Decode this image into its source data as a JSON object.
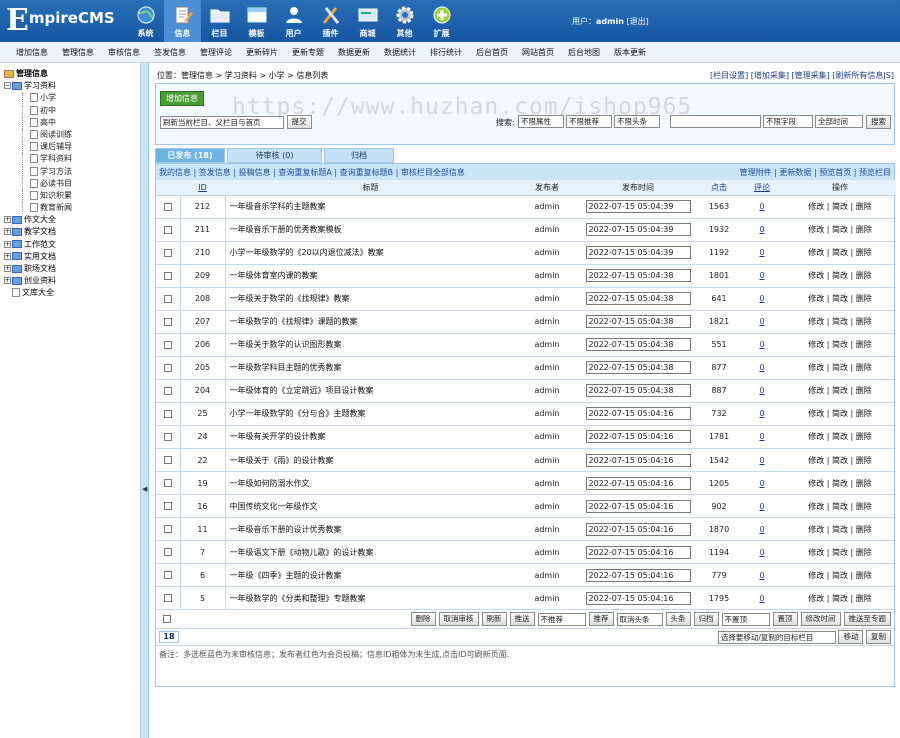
{
  "header": {
    "logo_first": "E",
    "logo_rest": "mpireCMS",
    "nav": [
      {
        "label": "系统",
        "icon": "globe-icon"
      },
      {
        "label": "信息",
        "icon": "pencil-doc-icon",
        "active": true
      },
      {
        "label": "栏目",
        "icon": "folder-icon"
      },
      {
        "label": "模板",
        "icon": "window-icon"
      },
      {
        "label": "用户",
        "icon": "user-icon"
      },
      {
        "label": "插件",
        "icon": "tools-icon"
      },
      {
        "label": "商城",
        "icon": "card-icon"
      },
      {
        "label": "其他",
        "icon": "gear-icon"
      },
      {
        "label": "扩展",
        "icon": "plus-icon"
      }
    ],
    "user_label": "用户：",
    "user_name": "admin",
    "logout": "[退出]"
  },
  "subnav": [
    "增加信息",
    "管理信息",
    "审核信息",
    "签发信息",
    "管理评论",
    "更新碎片",
    "更新专题",
    "数据更新",
    "数据统计",
    "排行统计",
    "后台首页",
    "网站首页",
    "后台地图",
    "版本更新"
  ],
  "sidebar": {
    "root": "管理信息",
    "groups": [
      {
        "label": "学习资料",
        "expanded": true,
        "children": [
          "小学",
          "初中",
          "高中",
          "阅读训练",
          "课后辅导",
          "学科资料",
          "学习方法",
          "必读书目",
          "知识积累",
          "教育新闻"
        ]
      },
      {
        "label": "作文大全"
      },
      {
        "label": "教学文档"
      },
      {
        "label": "工作范文"
      },
      {
        "label": "实用文档"
      },
      {
        "label": "职场文档"
      },
      {
        "label": "创业资料"
      },
      {
        "label": "文库大全",
        "leaf": true
      }
    ]
  },
  "crumbs": {
    "prefix": "位置：",
    "items": [
      "管理信息",
      "学习资料",
      "小学",
      "信息列表"
    ],
    "sep": " > "
  },
  "crumb_links": "[栏目设置] [增加采集] [管理采集] [刷新所有信息JS]",
  "toolbox": {
    "add_button": "增加信息",
    "refresh_select": "刷新当前栏目、父栏目与首页",
    "submit_button": "提交",
    "search_label": "搜索:",
    "filters": [
      "不限属性",
      "不限推荐",
      "不限头条"
    ],
    "search_value": "",
    "field_select": "不限字段",
    "time_select": "全部时间",
    "search_button": "搜索"
  },
  "tabs": [
    "已发布 (18)",
    "待审核 (0)",
    "归档"
  ],
  "linkbar_left": "我的信息 | 签发信息 | 投稿信息 | 查询重复标题A | 查询重复标题B | 审核栏目全部信息",
  "linkbar_right": "管理附件 | 更新数据 | 预览首页 | 预览栏目",
  "columns": [
    "ID",
    "标题",
    "发布者",
    "发布时间",
    "点击",
    "评论",
    "操作"
  ],
  "rows": [
    {
      "id": "212",
      "title": "一年级音乐学科的主题教案",
      "author": "admin",
      "time": "2022-07-15 05:04:39",
      "clicks": "1563",
      "comments": "0"
    },
    {
      "id": "211",
      "title": "一年级音乐下册的优秀教案模板",
      "author": "admin",
      "time": "2022-07-15 05:04:39",
      "clicks": "1932",
      "comments": "0"
    },
    {
      "id": "210",
      "title": "小学一年级数学的《20以内退位减法》教案",
      "author": "admin",
      "time": "2022-07-15 05:04:39",
      "clicks": "1192",
      "comments": "0"
    },
    {
      "id": "209",
      "title": "一年级体育室内课的教案",
      "author": "admin",
      "time": "2022-07-15 05:04:38",
      "clicks": "1801",
      "comments": "0"
    },
    {
      "id": "208",
      "title": "一年级关于数学的《找规律》教案",
      "author": "admin",
      "time": "2022-07-15 05:04:38",
      "clicks": "641",
      "comments": "0"
    },
    {
      "id": "207",
      "title": "一年级数学的《找规律》课题的教案",
      "author": "admin",
      "time": "2022-07-15 05:04:38",
      "clicks": "1821",
      "comments": "0"
    },
    {
      "id": "206",
      "title": "一年级关于数学的认识图形教案",
      "author": "admin",
      "time": "2022-07-15 05:04:38",
      "clicks": "551",
      "comments": "0"
    },
    {
      "id": "205",
      "title": "一年级数学科目主题的优秀教案",
      "author": "admin",
      "time": "2022-07-15 05:04:38",
      "clicks": "877",
      "comments": "0"
    },
    {
      "id": "204",
      "title": "一年级体育的《立定跳远》项目设计教案",
      "author": "admin",
      "time": "2022-07-15 05:04:38",
      "clicks": "887",
      "comments": "0"
    },
    {
      "id": "25",
      "title": "小学一年级数学的《分与合》主题教案",
      "author": "admin",
      "time": "2022-07-15 05:04:16",
      "clicks": "732",
      "comments": "0"
    },
    {
      "id": "24",
      "title": "一年级有关开学的设计教案",
      "author": "admin",
      "time": "2022-07-15 05:04:16",
      "clicks": "1781",
      "comments": "0"
    },
    {
      "id": "22",
      "title": "一年级关于《雨》的设计教案",
      "author": "admin",
      "time": "2022-07-15 05:04:16",
      "clicks": "1542",
      "comments": "0"
    },
    {
      "id": "19",
      "title": "一年级如何防溺水作文",
      "author": "admin",
      "time": "2022-07-15 05:04:16",
      "clicks": "1205",
      "comments": "0"
    },
    {
      "id": "16",
      "title": "中国传统文化一年级作文",
      "author": "admin",
      "time": "2022-07-15 05:04:16",
      "clicks": "902",
      "comments": "0"
    },
    {
      "id": "11",
      "title": "一年级音乐下册的设计优秀教案",
      "author": "admin",
      "time": "2022-07-15 05:04:16",
      "clicks": "1870",
      "comments": "0"
    },
    {
      "id": "7",
      "title": "一年级语文下册《动物儿歌》的设计教案",
      "author": "admin",
      "time": "2022-07-15 05:04:16",
      "clicks": "1194",
      "comments": "0"
    },
    {
      "id": "6",
      "title": "一年级《四季》主题的设计教案",
      "author": "admin",
      "time": "2022-07-15 05:04:16",
      "clicks": "779",
      "comments": "0"
    },
    {
      "id": "5",
      "title": "一年级数学的《分类和整理》专题教案",
      "author": "admin",
      "time": "2022-07-15 05:04:16",
      "clicks": "1795",
      "comments": "0"
    }
  ],
  "row_actions": [
    "修改",
    "简改",
    "删除"
  ],
  "actions": {
    "delete": "删除",
    "cancel_review": "取消审核",
    "refresh": "刷新",
    "push": "推送",
    "recommend_select": "不推荐",
    "recommend": "推荐",
    "headline_select": "取消头条",
    "headline": "头条",
    "archive": "归档",
    "top_select": "不置顶",
    "top": "置顶",
    "edit_time": "修改时间",
    "push_topic": "推送至专题"
  },
  "pager": {
    "total": "18",
    "move_select": "选择要移动/复制的目标栏目",
    "move": "移动",
    "copy": "复制"
  },
  "note": "备注：多选框蓝色为未审核信息；发布者红色为会员投稿；信息ID粗体为未生成,点击ID可刷新页面.",
  "watermark": "https://www.huzhan.com/ishop965"
}
